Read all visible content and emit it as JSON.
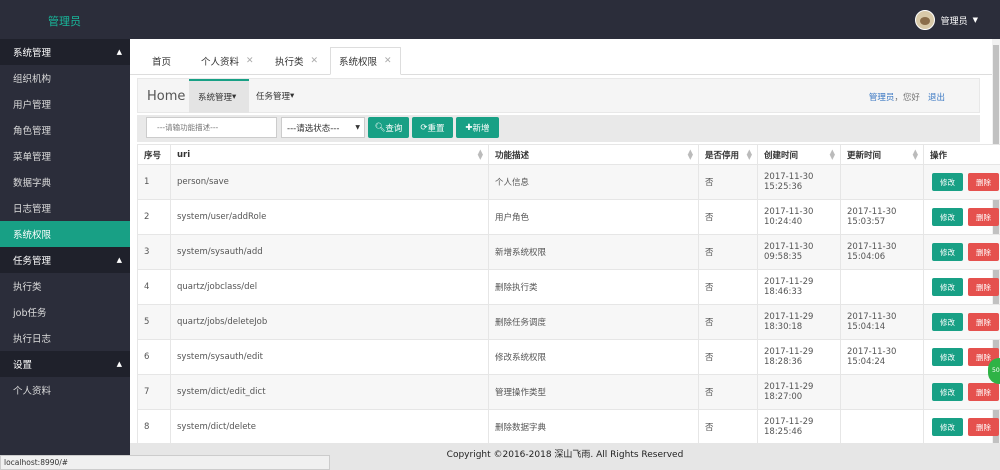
{
  "brand": "管理员",
  "user": {
    "name": "管理员"
  },
  "sidebar": {
    "sections": [
      {
        "title": "系统管理",
        "items": [
          "组织机构",
          "用户管理",
          "角色管理",
          "菜单管理",
          "数据字典",
          "日志管理",
          "系统权限"
        ]
      },
      {
        "title": "任务管理",
        "items": [
          "执行类",
          "job任务",
          "执行日志"
        ]
      },
      {
        "title": "设置",
        "items": [
          "个人资料"
        ]
      }
    ],
    "active": "系统权限"
  },
  "tabs": [
    {
      "label": "首页"
    },
    {
      "label": "个人资料"
    },
    {
      "label": "执行类"
    },
    {
      "label": "系统权限"
    }
  ],
  "panel": {
    "home": "Home",
    "menu1": "系统管理",
    "menu2": "任务管理",
    "greet_user": "管理员",
    "greet_text": "，您好",
    "logout": "退出"
  },
  "filter": {
    "placeholder": "---请输功能描述---",
    "status": "---请选状态---",
    "query": "查询",
    "reset": "重置",
    "add": "新增"
  },
  "table": {
    "headers": [
      "序号",
      "uri",
      "功能描述",
      "是否停用",
      "创建时间",
      "更新时间",
      "操作"
    ],
    "edit": "修改",
    "delete": "删除",
    "rows": [
      {
        "no": "1",
        "uri": "person/save",
        "desc": "个人信息",
        "disabled": "否",
        "created_d": "2017-11-30",
        "created_t": "15:25:36",
        "updated_d": "",
        "updated_t": ""
      },
      {
        "no": "2",
        "uri": "system/user/addRole",
        "desc": "用户角色",
        "disabled": "否",
        "created_d": "2017-11-30",
        "created_t": "10:24:40",
        "updated_d": "2017-11-30",
        "updated_t": "15:03:57"
      },
      {
        "no": "3",
        "uri": "system/sysauth/add",
        "desc": "新增系统权限",
        "disabled": "否",
        "created_d": "2017-11-30",
        "created_t": "09:58:35",
        "updated_d": "2017-11-30",
        "updated_t": "15:04:06"
      },
      {
        "no": "4",
        "uri": "quartz/jobclass/del",
        "desc": "删除执行类",
        "disabled": "否",
        "created_d": "2017-11-29",
        "created_t": "18:46:33",
        "updated_d": "",
        "updated_t": ""
      },
      {
        "no": "5",
        "uri": "quartz/jobs/deleteJob",
        "desc": "删除任务调度",
        "disabled": "否",
        "created_d": "2017-11-29",
        "created_t": "18:30:18",
        "updated_d": "2017-11-30",
        "updated_t": "15:04:14"
      },
      {
        "no": "6",
        "uri": "system/sysauth/edit",
        "desc": "修改系统权限",
        "disabled": "否",
        "created_d": "2017-11-29",
        "created_t": "18:28:36",
        "updated_d": "2017-11-30",
        "updated_t": "15:04:24"
      },
      {
        "no": "7",
        "uri": "system/dict/edit_dict",
        "desc": "管理操作类型",
        "disabled": "否",
        "created_d": "2017-11-29",
        "created_t": "18:27:00",
        "updated_d": "",
        "updated_t": ""
      },
      {
        "no": "8",
        "uri": "system/dict/delete",
        "desc": "删除数据字典",
        "disabled": "否",
        "created_d": "2017-11-29",
        "created_t": "18:25:46",
        "updated_d": "",
        "updated_t": ""
      }
    ]
  },
  "footer": "Copyright ©2016-2018 深山飞雨. All Rights Reserved",
  "statusbar": "localhost:8990/#",
  "float_badge": "50"
}
